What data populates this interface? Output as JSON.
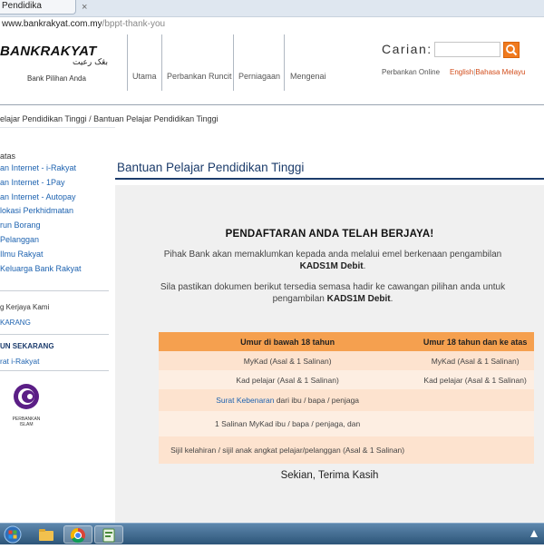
{
  "browser": {
    "tab_title": "Pendidika",
    "url_host": "www.bankrakyat.com.my",
    "url_path": "/bppt-thank-you"
  },
  "header": {
    "logo_text": "BANKRAKYAT",
    "logo_arabic": "بڠک رعيت",
    "tagline": "Bank Pilihan Anda",
    "nav": [
      "Utama",
      "Perbankan Runcit",
      "Perniagaan",
      "Mengenai"
    ],
    "search_label": "Carian:",
    "search_value": "",
    "online_link": "Perbankan Online",
    "lang_en": "English",
    "lang_bm": "Bahasa Melayu",
    "accent": "#f07a1e"
  },
  "breadcrumb": "elajar Pendidikan Tinggi  /  Bantuan Pelajar Pendidikan Tinggi",
  "sidebar": {
    "section_head": "atas",
    "links": [
      "an Internet - i-Rakyat",
      "an Internet - 1Pay",
      "an Internet - Autopay",
      "lokasi Perkhidmatan",
      "run Borang",
      "Pelanggan",
      "Ilmu Rakyat",
      "Keluarga Bank Rakyat"
    ],
    "career_text": "g Kerjaya Kami",
    "career_link": "KARANG",
    "apply_head": "UN SEKARANG",
    "apply_link": "rat i-Rakyat",
    "partner_caption": "PERBANKAN ISLAM"
  },
  "main": {
    "title": "Bantuan Pelajar Pendidikan Tinggi",
    "success": "PENDAFTARAN ANDA TELAH BERJAYA!",
    "p1_text": "Pihak Bank akan memaklumkan kepada anda melalui emel berkenaan pengambilan",
    "p1_bold": "KADS1M Debit",
    "p1_end": ".",
    "p2_text": "Sila pastikan dokumen berikut tersedia semasa hadir ke cawangan pilihan anda untuk pengambilan",
    "p2_bold": "KADS1M Debit",
    "p2_end": ".",
    "table_headers": [
      "Umur di bawah 18 tahun",
      "Umur 18 tahun dan ke atas"
    ],
    "rows": [
      [
        "MyKad (Asal & 1 Salinan)",
        "MyKad (Asal & 1 Salinan)"
      ],
      [
        "Kad pelajar (Asal & 1 Salinan)",
        "Kad pelajar (Asal & 1 Salinan)"
      ],
      [
        "",
        ""
      ],
      [
        "1 Salinan MyKad ibu / bapa / penjaga, dan",
        ""
      ],
      [
        "Sijil kelahiran / sijil anak angkat pelajar/pelanggan (Asal & 1 Salinan)",
        ""
      ]
    ],
    "row3_link": "Surat Kebenaran",
    "row3_text": " dari ibu / bapa / penjaga",
    "closing": "Sekian, Terima Kasih"
  }
}
